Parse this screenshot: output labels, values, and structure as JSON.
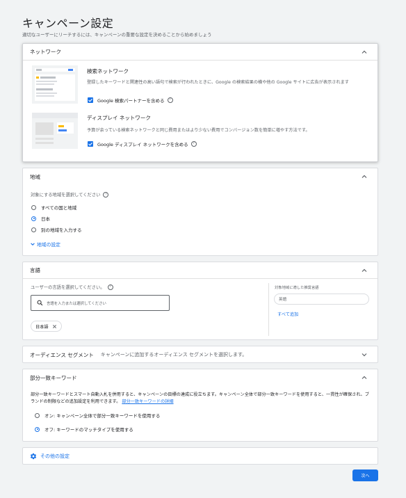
{
  "page": {
    "title": "キャンペーン設定",
    "subtitle": "適切なユーザーにリーチするには、キャンペーンの重要な設定を決めることから始めましょう"
  },
  "network": {
    "header": "ネットワーク",
    "search": {
      "title": "検索ネットワーク",
      "description": "登録したキーワードと関連性の高い語句で検索が行われたときに、Google の検索結果の横や他の Google サイトに広告が表示されます",
      "checkbox_label": "Google 検索パートナーを含める",
      "checked": true
    },
    "display": {
      "title": "ディスプレイ ネットワーク",
      "description": "予算が余っている検索ネットワークと同じ費用またはより少ない費用でコンバージョン数を簡単に増やす方法です。",
      "checkbox_label": "Google ディスプレイ ネットワークを含める",
      "checked": true
    }
  },
  "location": {
    "header": "地域",
    "prompt": "対象にする地域を選択してください",
    "options": [
      "すべての国と地域",
      "日本",
      "別の地域を入力する"
    ],
    "selected": "日本",
    "settings_link": "地域の設定"
  },
  "language": {
    "header": "言語",
    "prompt": "ユーザーの言語を選択してください。",
    "search_placeholder": "言語を入力または選択してください",
    "chip": "日本語",
    "suggest_title": "対象地域に適した推奨言語",
    "suggest_chip": "英語",
    "add_all": "すべて追加"
  },
  "audience": {
    "header": "オーディエンス セグメント",
    "hint": "キャンペーンに追加するオーディエンス セグメントを選択します。"
  },
  "broad_match": {
    "header": "部分一致キーワード",
    "description": "部分一致キーワードとスマート自動入札を併用すると、キャンペーンの目標の達成に役立ちます。キャンペーン全体で部分一致キーワードを使用すると、一貫性が確保され、ブランドの制限などの追加設定を利用できます。",
    "link": "部分一致キーワードの詳細",
    "options": [
      "オン: キャンペーン全体で部分一致キーワードを使用する",
      "オフ: キーワードのマッチタイプを使用する"
    ],
    "selected": "オフ: キーワードのマッチタイプを使用する"
  },
  "more_settings": {
    "label": "その他の設定"
  },
  "next_button": {
    "label": "次へ"
  },
  "colors": {
    "accent": "#1a73e8",
    "background": "#f1f3f4"
  }
}
